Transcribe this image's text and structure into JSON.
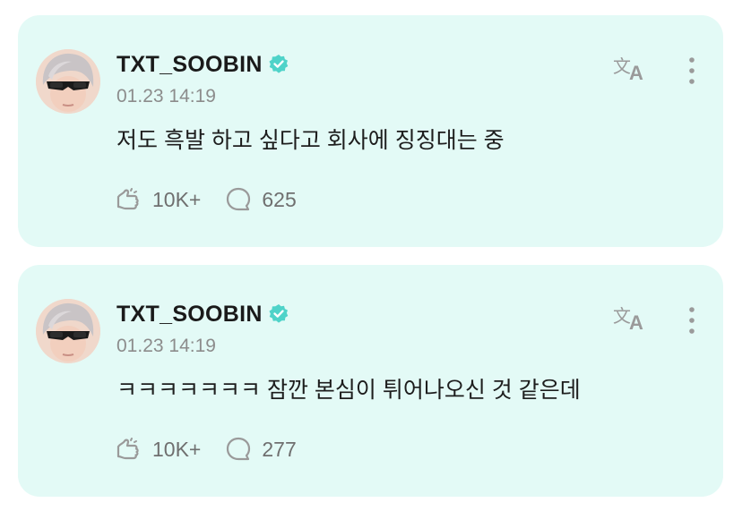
{
  "posts": [
    {
      "username": "TXT_SOOBIN",
      "verified": true,
      "timestamp": "01.23 14:19",
      "text": "저도 흑발 하고 싶다고 회사에 징징대는 중",
      "likes": "10K+",
      "comments": "625"
    },
    {
      "username": "TXT_SOOBIN",
      "verified": true,
      "timestamp": "01.23 14:19",
      "text": "ㅋㅋㅋㅋㅋㅋㅋ 잠깐 본심이 튀어나오신 것 같은데",
      "likes": "10K+",
      "comments": "277"
    }
  ],
  "icons": {
    "verified": "verified-badge-icon",
    "like": "like-icon",
    "comment": "comment-icon",
    "translate": "translate-icon",
    "more": "more-vertical-icon"
  },
  "colors": {
    "card_background": "#e3faf6",
    "verified_badge": "#4fd3c9",
    "icon_gray": "#9a9a9a",
    "timestamp_gray": "#8c8c8c"
  }
}
